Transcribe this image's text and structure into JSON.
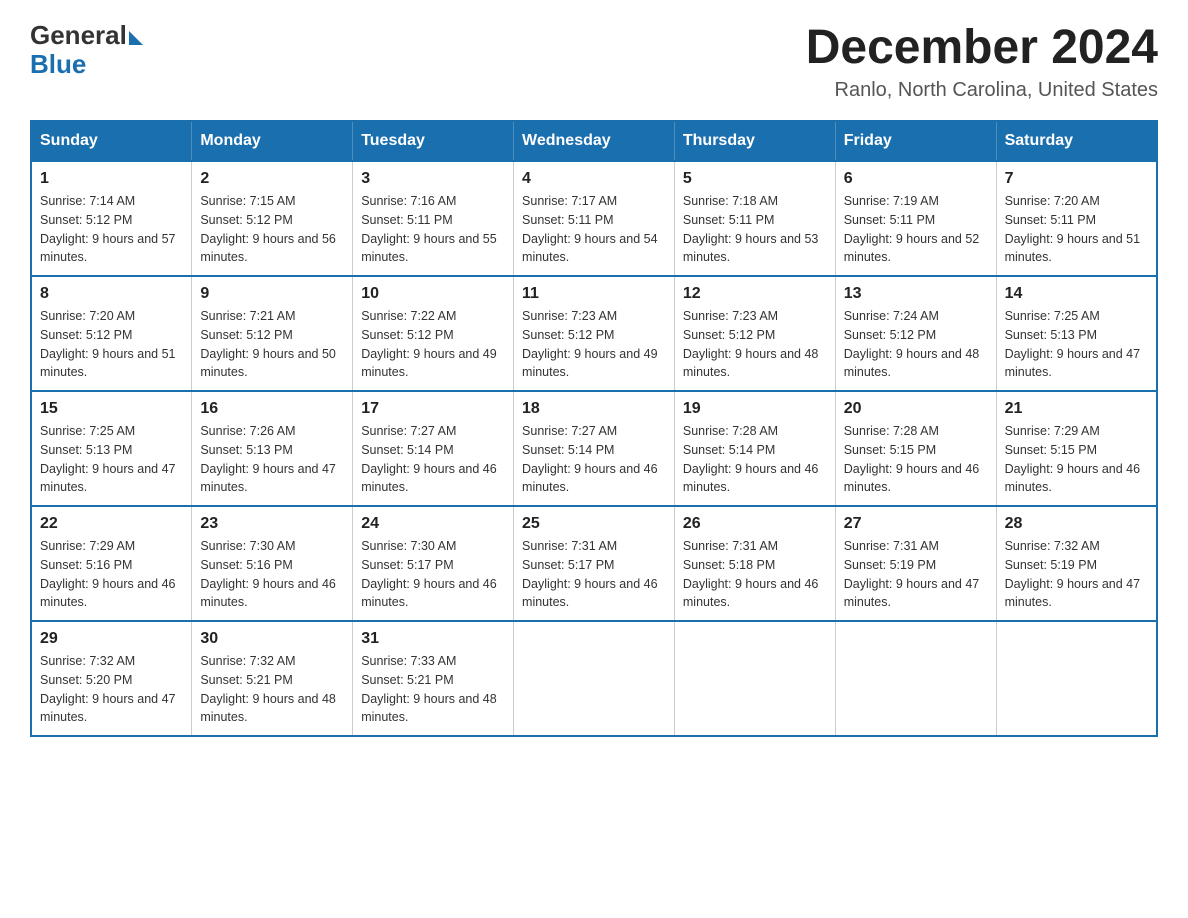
{
  "header": {
    "logo_general": "General",
    "logo_blue": "Blue",
    "month_year": "December 2024",
    "location": "Ranlo, North Carolina, United States"
  },
  "weekdays": [
    "Sunday",
    "Monday",
    "Tuesday",
    "Wednesday",
    "Thursday",
    "Friday",
    "Saturday"
  ],
  "weeks": [
    [
      {
        "day": "1",
        "sunrise": "7:14 AM",
        "sunset": "5:12 PM",
        "daylight": "9 hours and 57 minutes."
      },
      {
        "day": "2",
        "sunrise": "7:15 AM",
        "sunset": "5:12 PM",
        "daylight": "9 hours and 56 minutes."
      },
      {
        "day": "3",
        "sunrise": "7:16 AM",
        "sunset": "5:11 PM",
        "daylight": "9 hours and 55 minutes."
      },
      {
        "day": "4",
        "sunrise": "7:17 AM",
        "sunset": "5:11 PM",
        "daylight": "9 hours and 54 minutes."
      },
      {
        "day": "5",
        "sunrise": "7:18 AM",
        "sunset": "5:11 PM",
        "daylight": "9 hours and 53 minutes."
      },
      {
        "day": "6",
        "sunrise": "7:19 AM",
        "sunset": "5:11 PM",
        "daylight": "9 hours and 52 minutes."
      },
      {
        "day": "7",
        "sunrise": "7:20 AM",
        "sunset": "5:11 PM",
        "daylight": "9 hours and 51 minutes."
      }
    ],
    [
      {
        "day": "8",
        "sunrise": "7:20 AM",
        "sunset": "5:12 PM",
        "daylight": "9 hours and 51 minutes."
      },
      {
        "day": "9",
        "sunrise": "7:21 AM",
        "sunset": "5:12 PM",
        "daylight": "9 hours and 50 minutes."
      },
      {
        "day": "10",
        "sunrise": "7:22 AM",
        "sunset": "5:12 PM",
        "daylight": "9 hours and 49 minutes."
      },
      {
        "day": "11",
        "sunrise": "7:23 AM",
        "sunset": "5:12 PM",
        "daylight": "9 hours and 49 minutes."
      },
      {
        "day": "12",
        "sunrise": "7:23 AM",
        "sunset": "5:12 PM",
        "daylight": "9 hours and 48 minutes."
      },
      {
        "day": "13",
        "sunrise": "7:24 AM",
        "sunset": "5:12 PM",
        "daylight": "9 hours and 48 minutes."
      },
      {
        "day": "14",
        "sunrise": "7:25 AM",
        "sunset": "5:13 PM",
        "daylight": "9 hours and 47 minutes."
      }
    ],
    [
      {
        "day": "15",
        "sunrise": "7:25 AM",
        "sunset": "5:13 PM",
        "daylight": "9 hours and 47 minutes."
      },
      {
        "day": "16",
        "sunrise": "7:26 AM",
        "sunset": "5:13 PM",
        "daylight": "9 hours and 47 minutes."
      },
      {
        "day": "17",
        "sunrise": "7:27 AM",
        "sunset": "5:14 PM",
        "daylight": "9 hours and 46 minutes."
      },
      {
        "day": "18",
        "sunrise": "7:27 AM",
        "sunset": "5:14 PM",
        "daylight": "9 hours and 46 minutes."
      },
      {
        "day": "19",
        "sunrise": "7:28 AM",
        "sunset": "5:14 PM",
        "daylight": "9 hours and 46 minutes."
      },
      {
        "day": "20",
        "sunrise": "7:28 AM",
        "sunset": "5:15 PM",
        "daylight": "9 hours and 46 minutes."
      },
      {
        "day": "21",
        "sunrise": "7:29 AM",
        "sunset": "5:15 PM",
        "daylight": "9 hours and 46 minutes."
      }
    ],
    [
      {
        "day": "22",
        "sunrise": "7:29 AM",
        "sunset": "5:16 PM",
        "daylight": "9 hours and 46 minutes."
      },
      {
        "day": "23",
        "sunrise": "7:30 AM",
        "sunset": "5:16 PM",
        "daylight": "9 hours and 46 minutes."
      },
      {
        "day": "24",
        "sunrise": "7:30 AM",
        "sunset": "5:17 PM",
        "daylight": "9 hours and 46 minutes."
      },
      {
        "day": "25",
        "sunrise": "7:31 AM",
        "sunset": "5:17 PM",
        "daylight": "9 hours and 46 minutes."
      },
      {
        "day": "26",
        "sunrise": "7:31 AM",
        "sunset": "5:18 PM",
        "daylight": "9 hours and 46 minutes."
      },
      {
        "day": "27",
        "sunrise": "7:31 AM",
        "sunset": "5:19 PM",
        "daylight": "9 hours and 47 minutes."
      },
      {
        "day": "28",
        "sunrise": "7:32 AM",
        "sunset": "5:19 PM",
        "daylight": "9 hours and 47 minutes."
      }
    ],
    [
      {
        "day": "29",
        "sunrise": "7:32 AM",
        "sunset": "5:20 PM",
        "daylight": "9 hours and 47 minutes."
      },
      {
        "day": "30",
        "sunrise": "7:32 AM",
        "sunset": "5:21 PM",
        "daylight": "9 hours and 48 minutes."
      },
      {
        "day": "31",
        "sunrise": "7:33 AM",
        "sunset": "5:21 PM",
        "daylight": "9 hours and 48 minutes."
      },
      null,
      null,
      null,
      null
    ]
  ]
}
